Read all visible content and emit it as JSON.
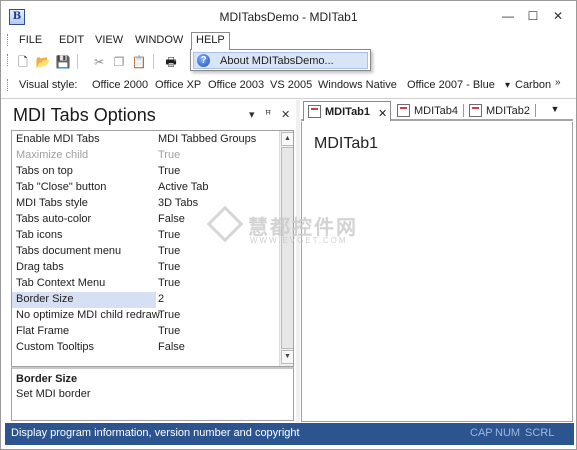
{
  "window": {
    "title": "MDITabsDemo - MDITab1",
    "app_icon_letter": "B",
    "minimize_glyph": "—",
    "maximize_glyph": "☐",
    "close_glyph": "✕"
  },
  "menubar": {
    "items": [
      {
        "label": "FILE"
      },
      {
        "label": "EDIT"
      },
      {
        "label": "VIEW"
      },
      {
        "label": "WINDOW"
      },
      {
        "label": "HELP"
      }
    ],
    "open_menu": "HELP"
  },
  "help_menu": {
    "items": [
      {
        "label": "About MDITabsDemo...",
        "icon": "help-icon"
      }
    ]
  },
  "toolbar": {
    "buttons": [
      "new-file-icon",
      "open-folder-icon",
      "save-icon",
      "cut-icon",
      "copy-icon",
      "paste-icon",
      "print-icon"
    ],
    "glyphs": {
      "new": "🗋",
      "open": "📂",
      "save": "💾",
      "cut": "✂",
      "copy": "❐",
      "paste": "📋",
      "print": "🖶"
    }
  },
  "visual_style": {
    "label": "Visual style:",
    "options": [
      "Office 2000",
      "Office XP",
      "Office 2003",
      "VS 2005",
      "Windows Native",
      "Office 2007 - Blue",
      "Carbon"
    ],
    "dropdown_glyph": "▾",
    "overflow_glyph": "»"
  },
  "options_pane": {
    "title": "MDI Tabs Options",
    "controls": {
      "dropdown": "▾",
      "pin": "ꟸ",
      "close": "✕"
    },
    "properties": [
      {
        "name": "Enable MDI Tabs",
        "value": "MDI Tabbed Groups",
        "disabled": false
      },
      {
        "name": "Maximize child",
        "value": "True",
        "disabled": true
      },
      {
        "name": "Tabs on top",
        "value": "True",
        "disabled": false
      },
      {
        "name": "Tab \"Close\" button",
        "value": "Active Tab",
        "disabled": false
      },
      {
        "name": "MDI Tabs style",
        "value": "3D Tabs",
        "disabled": false
      },
      {
        "name": "Tabs auto-color",
        "value": "False",
        "disabled": false
      },
      {
        "name": "Tab icons",
        "value": "True",
        "disabled": false
      },
      {
        "name": "Tabs document menu",
        "value": "True",
        "disabled": false
      },
      {
        "name": "Drag tabs",
        "value": "True",
        "disabled": false
      },
      {
        "name": "Tab Context Menu",
        "value": "True",
        "disabled": false
      },
      {
        "name": "Border Size",
        "value": "2",
        "disabled": false,
        "selected": true
      },
      {
        "name": "No optimize MDI child redraw",
        "value": "True",
        "disabled": false
      },
      {
        "name": "Flat Frame",
        "value": "True",
        "disabled": false
      },
      {
        "name": "Custom Tooltips",
        "value": "False",
        "disabled": false
      }
    ],
    "description": {
      "title": "Border Size",
      "text": "Set MDI border"
    }
  },
  "mdi": {
    "tabs": [
      {
        "label": "MDITab1",
        "active": true
      },
      {
        "label": "MDITab4",
        "active": false
      },
      {
        "label": "MDITab2",
        "active": false
      }
    ],
    "tab_close_glyph": "✕",
    "tab_menu_glyph": "▼",
    "document_title": "MDITab1"
  },
  "statusbar": {
    "message": "Display program information, version number and copyright",
    "indicators": [
      "CAP",
      "NUM",
      "SCRL"
    ]
  },
  "watermark": {
    "cn": "慧都控件网",
    "url": "WWW.EVGET.COM"
  },
  "colors": {
    "status_bar": "#2c5590",
    "selected_row": "#d6e0f2",
    "menu_highlight": "#d9e4f6"
  }
}
